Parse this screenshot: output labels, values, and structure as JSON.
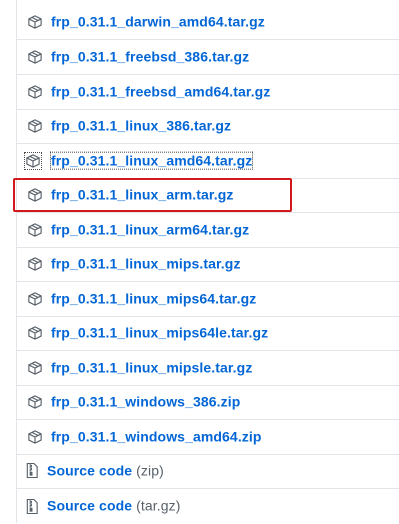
{
  "assets": [
    {
      "name": "frp_0.31.1_darwin_amd64.tar.gz",
      "icon": "package-icon"
    },
    {
      "name": "frp_0.31.1_freebsd_386.tar.gz",
      "icon": "package-icon"
    },
    {
      "name": "frp_0.31.1_freebsd_amd64.tar.gz",
      "icon": "package-icon"
    },
    {
      "name": "frp_0.31.1_linux_386.tar.gz",
      "icon": "package-icon"
    },
    {
      "name": "frp_0.31.1_linux_amd64.tar.gz",
      "icon": "package-icon"
    },
    {
      "name": "frp_0.31.1_linux_arm.tar.gz",
      "icon": "package-icon"
    },
    {
      "name": "frp_0.31.1_linux_arm64.tar.gz",
      "icon": "package-icon"
    },
    {
      "name": "frp_0.31.1_linux_mips.tar.gz",
      "icon": "package-icon"
    },
    {
      "name": "frp_0.31.1_linux_mips64.tar.gz",
      "icon": "package-icon"
    },
    {
      "name": "frp_0.31.1_linux_mips64le.tar.gz",
      "icon": "package-icon"
    },
    {
      "name": "frp_0.31.1_linux_mipsle.tar.gz",
      "icon": "package-icon"
    },
    {
      "name": "frp_0.31.1_windows_386.zip",
      "icon": "package-icon"
    },
    {
      "name": "frp_0.31.1_windows_amd64.zip",
      "icon": "package-icon"
    }
  ],
  "source": [
    {
      "label": "Source code",
      "format": "(zip)",
      "icon": "file-zip-icon"
    },
    {
      "label": "Source code",
      "format": "(tar.gz)",
      "icon": "file-zip-icon"
    }
  ],
  "colors": {
    "link": "#0366d6",
    "muted": "#586069",
    "border": "#e1e4e8",
    "highlight": "#d0181d"
  }
}
